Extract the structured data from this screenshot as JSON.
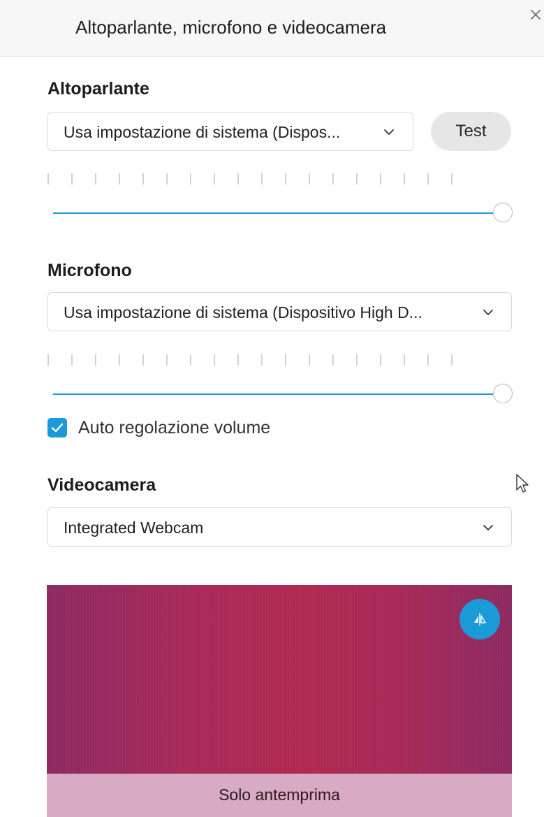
{
  "header": {
    "title": "Altoparlante, microfono e videocamera"
  },
  "speaker": {
    "title": "Altoparlante",
    "device": "Usa impostazione di sistema (Dispos...",
    "test_label": "Test",
    "volume_percent": 100
  },
  "microphone": {
    "title": "Microfono",
    "device": "Usa impostazione di sistema (Dispositivo High D...",
    "volume_percent": 100,
    "auto_adjust_label": "Auto regolazione volume",
    "auto_adjust_checked": true
  },
  "camera": {
    "title": "Videocamera",
    "device": "Integrated Webcam",
    "preview_label": "Solo antemprima"
  },
  "colors": {
    "accent": "#1a9bd7",
    "preview_overlay": "#d8aac3"
  }
}
